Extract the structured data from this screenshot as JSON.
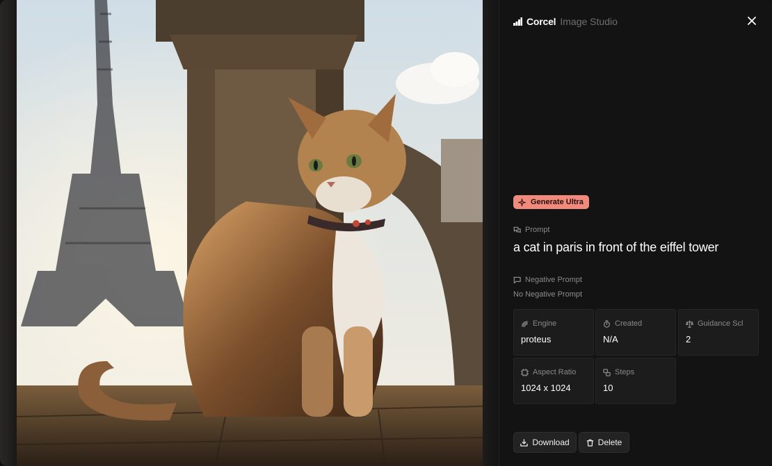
{
  "brand": {
    "name": "Corcel",
    "subtitle": "Image Studio",
    "logo_icon": "bars-logo-icon"
  },
  "close_icon": "close-icon",
  "badge": {
    "label": "Generate Ultra",
    "icon": "sparkle-icon",
    "color": "#f08a7c"
  },
  "prompt": {
    "label": "Prompt",
    "icon": "chat-icon",
    "text": "a cat in paris in front of the eiffel tower"
  },
  "negative_prompt": {
    "label": "Negative Prompt",
    "icon": "message-square-icon",
    "text": "No Negative Prompt"
  },
  "details": [
    {
      "label": "Engine",
      "value": "proteus",
      "icon": "engine-icon"
    },
    {
      "label": "Created",
      "value": "N/A",
      "icon": "timer-icon"
    },
    {
      "label": "Guidance Scl",
      "value": "2",
      "icon": "scale-icon"
    },
    {
      "label": "Aspect Ratio",
      "value": "1024 x 1024",
      "icon": "aspect-icon"
    },
    {
      "label": "Steps",
      "value": "10",
      "icon": "steps-icon"
    }
  ],
  "actions": {
    "download": "Download",
    "delete": "Delete"
  },
  "image": {
    "description_icon": "generated-image"
  }
}
